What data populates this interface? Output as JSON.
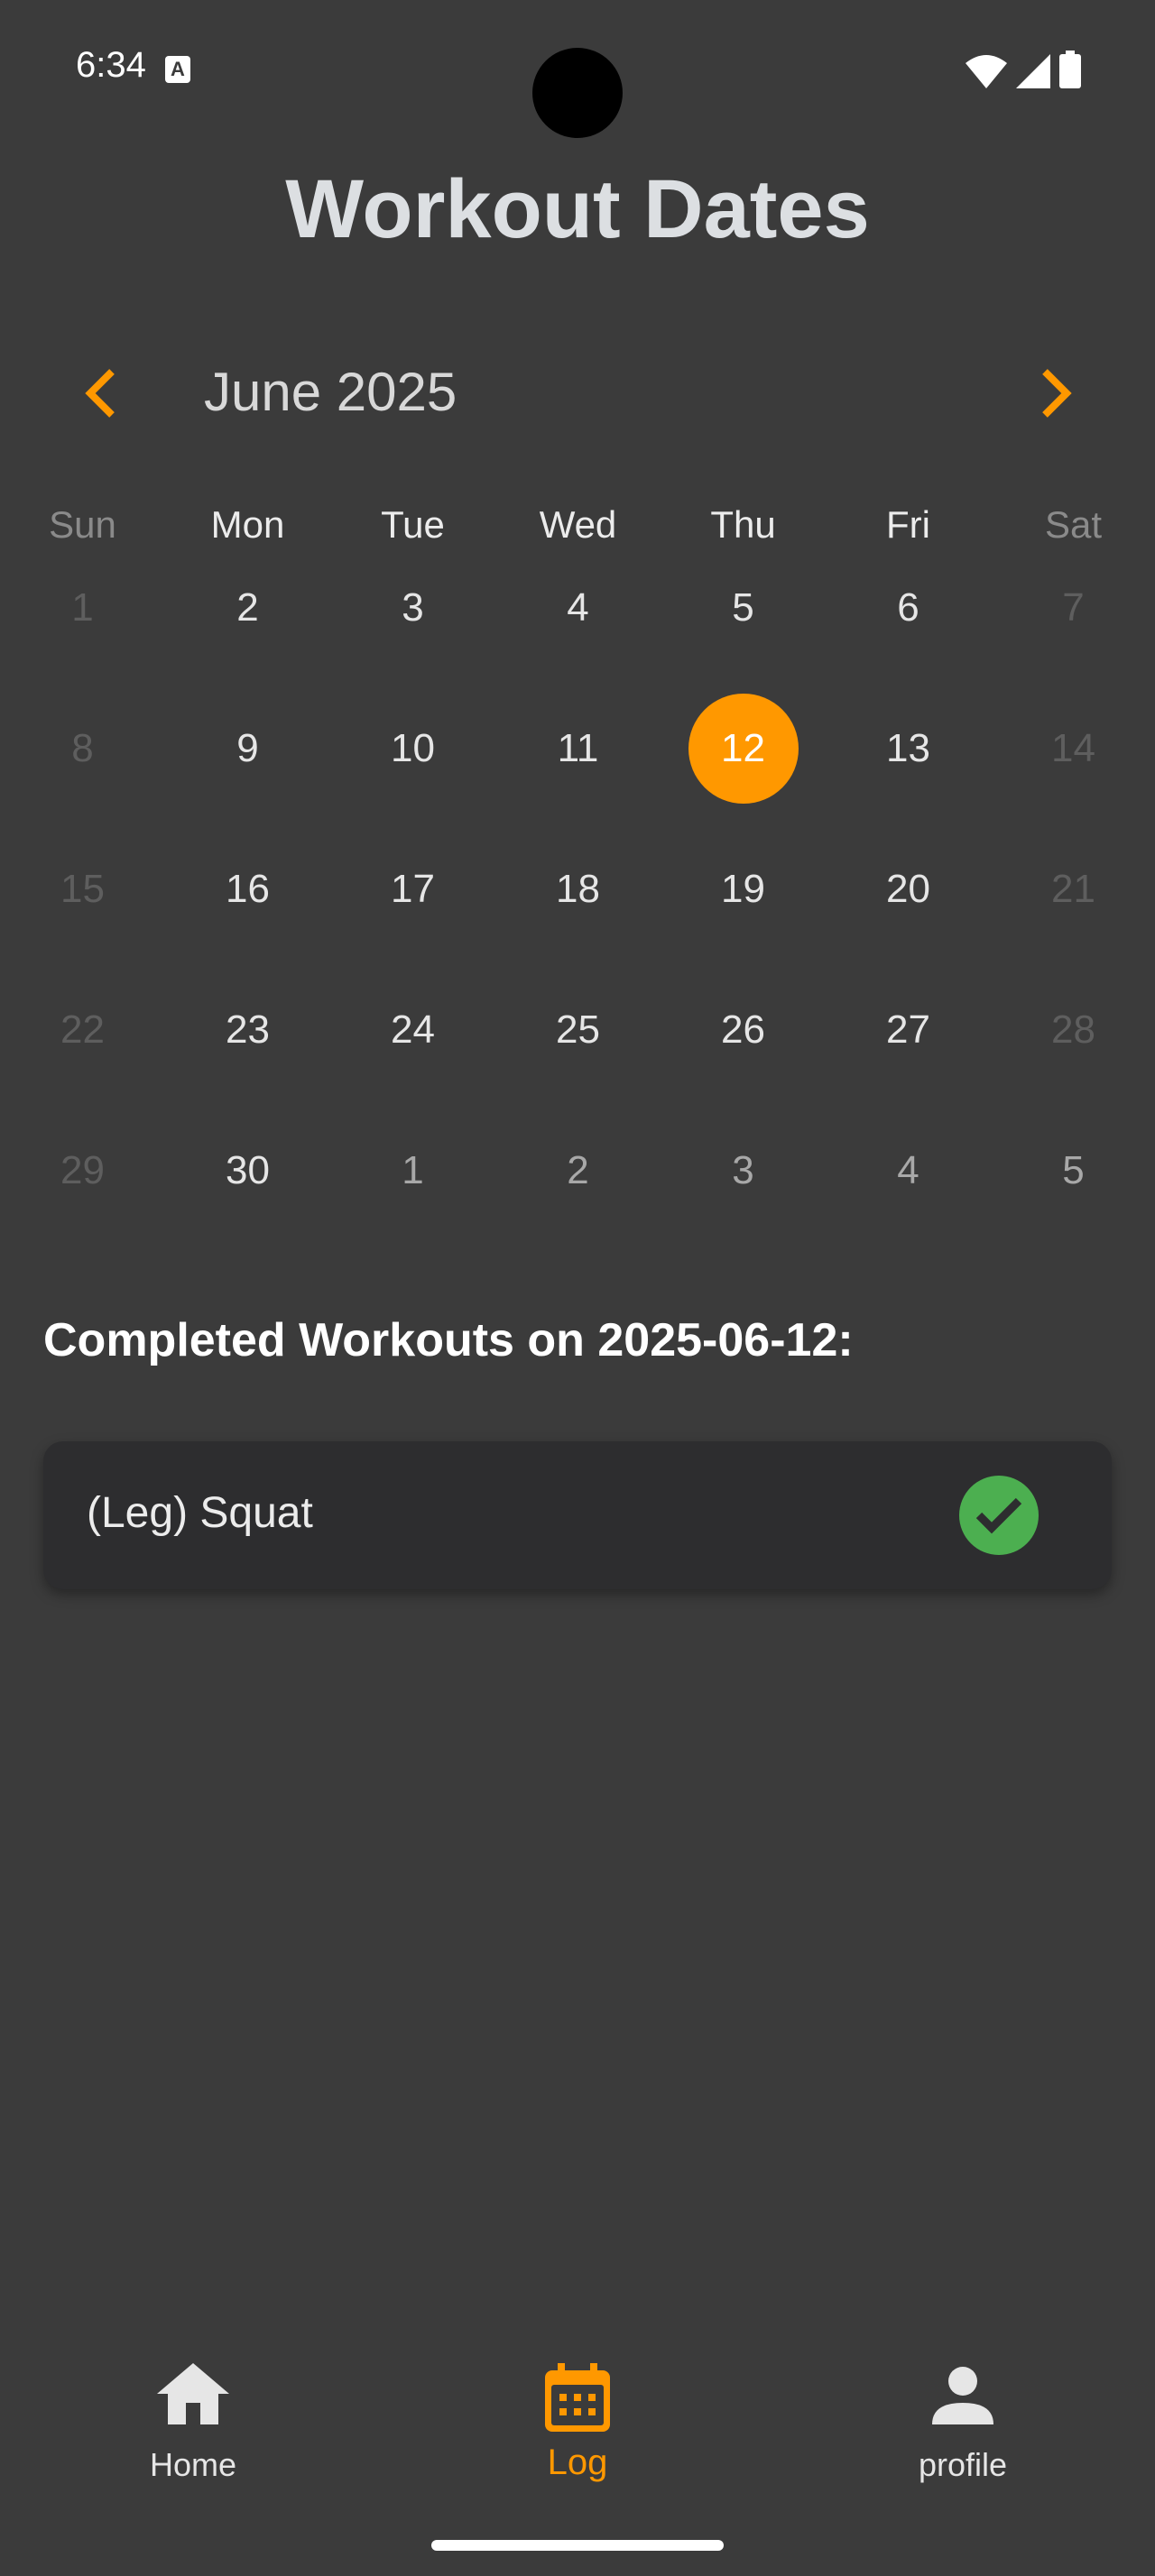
{
  "status_bar": {
    "time": "6:34",
    "notification_icon": "text-a-icon",
    "icons": [
      "wifi-icon",
      "signal-icon",
      "battery-icon"
    ]
  },
  "page_title": "Workout Dates",
  "calendar": {
    "month_label": "June 2025",
    "prev_icon": "chevron-left-icon",
    "next_icon": "chevron-right-icon",
    "accent_color": "#ff9800",
    "weekdays": [
      "Sun",
      "Mon",
      "Tue",
      "Wed",
      "Thu",
      "Fri",
      "Sat"
    ],
    "weeks": [
      [
        "1",
        "2",
        "3",
        "4",
        "5",
        "6",
        "7"
      ],
      [
        "8",
        "9",
        "10",
        "11",
        "12",
        "13",
        "14"
      ],
      [
        "15",
        "16",
        "17",
        "18",
        "19",
        "20",
        "21"
      ],
      [
        "22",
        "23",
        "24",
        "25",
        "26",
        "27",
        "28"
      ],
      [
        "29",
        "30",
        "1",
        "2",
        "3",
        "4",
        "5"
      ]
    ],
    "selected_day": "12"
  },
  "completed_section": {
    "title": "Completed Workouts on 2025-06-12:",
    "items": [
      {
        "name": "(Leg) Squat",
        "status_icon": "check-circle-icon",
        "status_color": "#4caf50"
      }
    ]
  },
  "bottom_nav": {
    "items": [
      {
        "label": "Home",
        "icon": "home-icon",
        "active": false
      },
      {
        "label": "Log",
        "icon": "calendar-icon",
        "active": true
      },
      {
        "label": "profile",
        "icon": "person-icon",
        "active": false
      }
    ]
  }
}
